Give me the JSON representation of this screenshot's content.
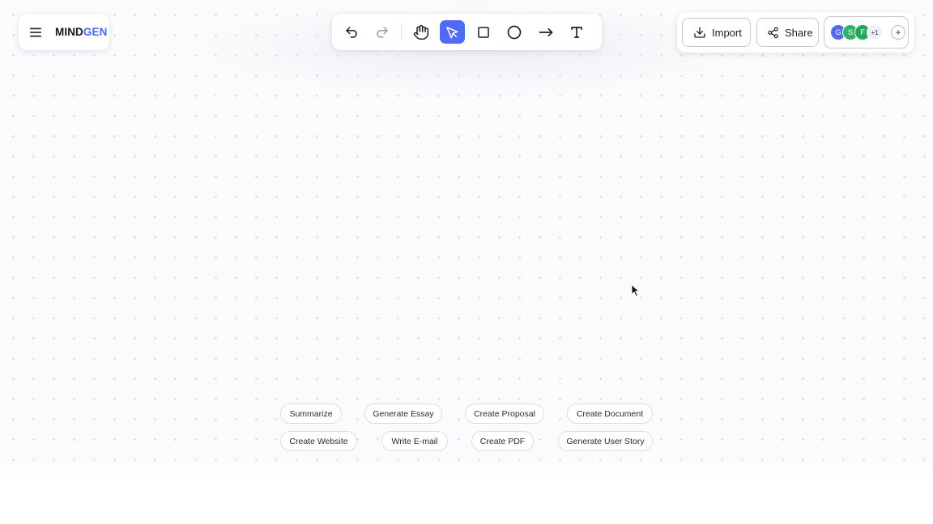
{
  "brand": {
    "name_part1": "MIND",
    "name_part2": "GEN",
    "accent_color": "#4a67f0"
  },
  "toolbar": {
    "tools": [
      {
        "name": "undo",
        "icon": "undo-icon",
        "state": "enabled"
      },
      {
        "name": "redo",
        "icon": "redo-icon",
        "state": "disabled"
      },
      {
        "name": "hand",
        "icon": "hand-icon",
        "state": "enabled"
      },
      {
        "name": "select",
        "icon": "pointer-icon",
        "state": "active"
      },
      {
        "name": "rectangle",
        "icon": "square-icon",
        "state": "enabled"
      },
      {
        "name": "ellipse",
        "icon": "circle-icon",
        "state": "enabled"
      },
      {
        "name": "arrow",
        "icon": "arrow-right-icon",
        "state": "enabled"
      },
      {
        "name": "text",
        "icon": "text-icon",
        "state": "enabled"
      }
    ],
    "active_color": "#4f6bf5"
  },
  "actions": {
    "import_label": "Import",
    "share_label": "Share",
    "collaborators": [
      {
        "initial": "G",
        "color": "#4f6bf5"
      },
      {
        "initial": "S",
        "color": "#2fb36a"
      },
      {
        "initial": "F",
        "color": "#22a85a"
      }
    ],
    "more_count": "+1",
    "add_label": "+"
  },
  "suggestions": {
    "row1": [
      "Summarize",
      "Generate Essay",
      "Create Proposal",
      "Create Document"
    ],
    "row2": [
      "Create Website",
      "Write E-mail",
      "Create PDF",
      "Generate User Story"
    ]
  }
}
